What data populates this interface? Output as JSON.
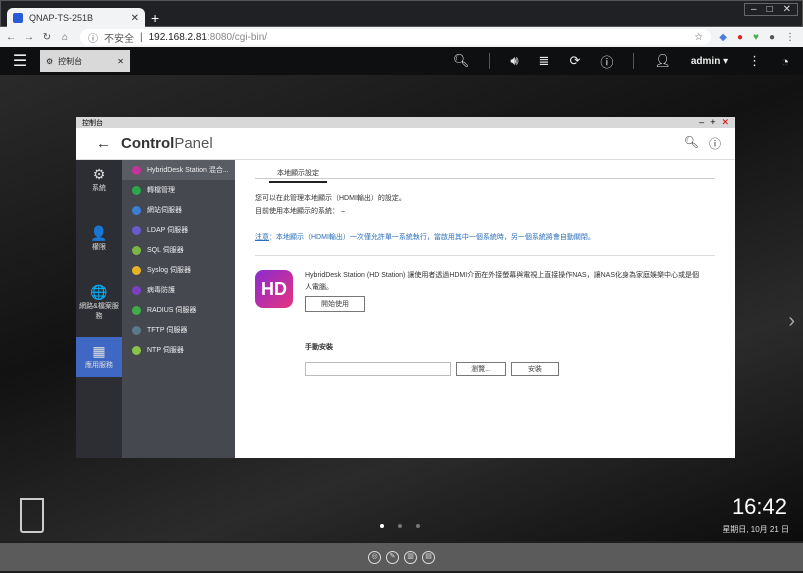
{
  "browser": {
    "tab_title": "QNAP-TS-251B",
    "new_tab": "+",
    "address_warning": "不安全",
    "url_host": "192.168.2.81",
    "url_rest": ":8080/cgi-bin/"
  },
  "qts": {
    "app_tab": "控制台",
    "user": "admin"
  },
  "window": {
    "title": "控制台",
    "app_name_bold": "Control",
    "app_name_light": "Panel"
  },
  "sidebar": [
    {
      "label": "系統",
      "icon": "⚙"
    },
    {
      "label": "權限",
      "icon": "👤"
    },
    {
      "label": "網路&檔案服務",
      "icon": "🌐"
    },
    {
      "label": "應用服務",
      "icon": "▦"
    }
  ],
  "menu": [
    {
      "label": "HybridDesk Station 混合...",
      "color": "#c2339b"
    },
    {
      "label": "轉檔管理",
      "color": "#2aa84a"
    },
    {
      "label": "網站伺服器",
      "color": "#3a7fd6"
    },
    {
      "label": "LDAP 伺服器",
      "color": "#6a5acd"
    },
    {
      "label": "SQL 伺服器",
      "color": "#7bb843"
    },
    {
      "label": "Syslog 伺服器",
      "color": "#e6b422"
    },
    {
      "label": "病毒防護",
      "color": "#7b3fc4"
    },
    {
      "label": "RADIUS 伺服器",
      "color": "#3fae49"
    },
    {
      "label": "TFTP 伺服器",
      "color": "#5a7a8c"
    },
    {
      "label": "NTP 伺服器",
      "color": "#8bc34a"
    }
  ],
  "content": {
    "tab": "本地顯示設定",
    "line1": "您可以在此管理本地顯示（HDMI輸出）的設定。",
    "line2": "目前使用本地顯示的系統：  –",
    "note_label": "注意",
    "note": "：本地顯示（HDMI輸出）一次僅允許單一系統執行，當啟用其中一個系統時，另一個系統將會自動關閉。",
    "logo_text": "HD",
    "desc": "HybridDesk Station (HD Station) 讓使用者透過HDMI介面在外接螢幕與電視上直接操作NAS，讓NAS化身為家庭娛樂中心或是個人電腦。",
    "start_btn": "開始使用",
    "manual_title": "手動安裝",
    "browse_btn": "瀏覽...",
    "install_btn": "安裝"
  },
  "desktop": {
    "time": "16:42",
    "date": "星期日, 10月 21 日"
  }
}
